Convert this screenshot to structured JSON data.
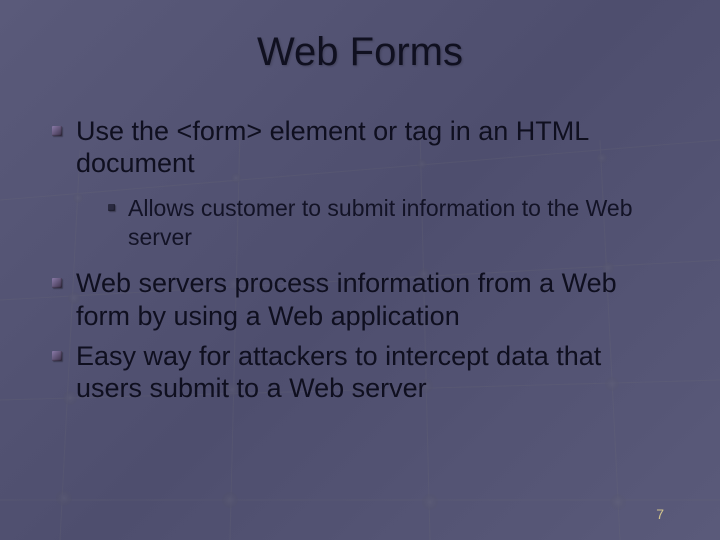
{
  "title": "Web Forms",
  "bullets": {
    "0": "Use the <form> element or tag in an HTML document",
    "1": "Web servers process information from a Web form by using a Web application",
    "2": "Easy way for attackers to intercept data that users submit to a Web server"
  },
  "sub": {
    "0": "Allows customer to submit information to the Web server"
  },
  "page_number": "7"
}
